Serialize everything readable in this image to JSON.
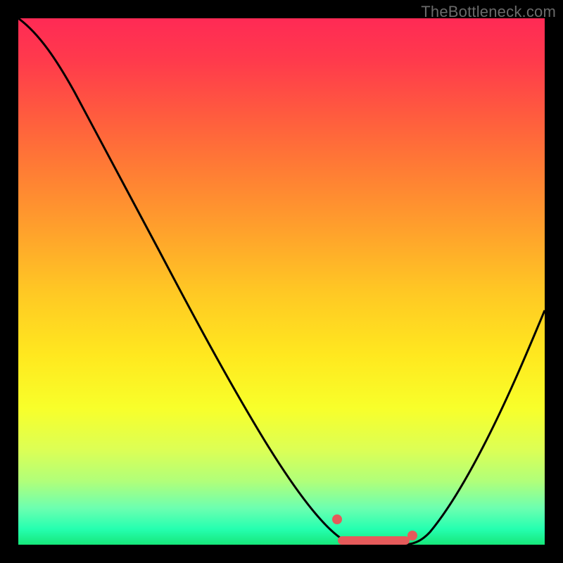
{
  "watermark": "TheBottleneck.com",
  "chart_data": {
    "type": "line",
    "title": "",
    "xlabel": "",
    "ylabel": "",
    "xlim": [
      0,
      100
    ],
    "ylim": [
      0,
      100
    ],
    "grid": false,
    "series": [
      {
        "name": "bottleneck-curve",
        "x": [
          0,
          4,
          8,
          12,
          16,
          20,
          24,
          28,
          32,
          36,
          40,
          44,
          48,
          52,
          56,
          58,
          60,
          62,
          64,
          66,
          68,
          70,
          72,
          74,
          78,
          82,
          86,
          90,
          94,
          98,
          100
        ],
        "values": [
          100,
          97,
          94,
          90,
          85,
          79,
          73,
          67,
          60,
          53,
          46,
          39,
          32,
          25,
          18,
          14,
          10,
          7,
          4,
          1,
          0,
          0,
          0,
          1,
          4,
          9,
          16,
          24,
          33,
          43,
          48
        ]
      }
    ],
    "highlight_region": {
      "name": "optimal-range",
      "x_start": 61,
      "x_end": 75,
      "color": "#e55a5a"
    },
    "highlight_points": [
      {
        "x": 61,
        "y": 6
      },
      {
        "x": 75,
        "y": 2
      }
    ],
    "background": "red-yellow-green vertical gradient"
  }
}
